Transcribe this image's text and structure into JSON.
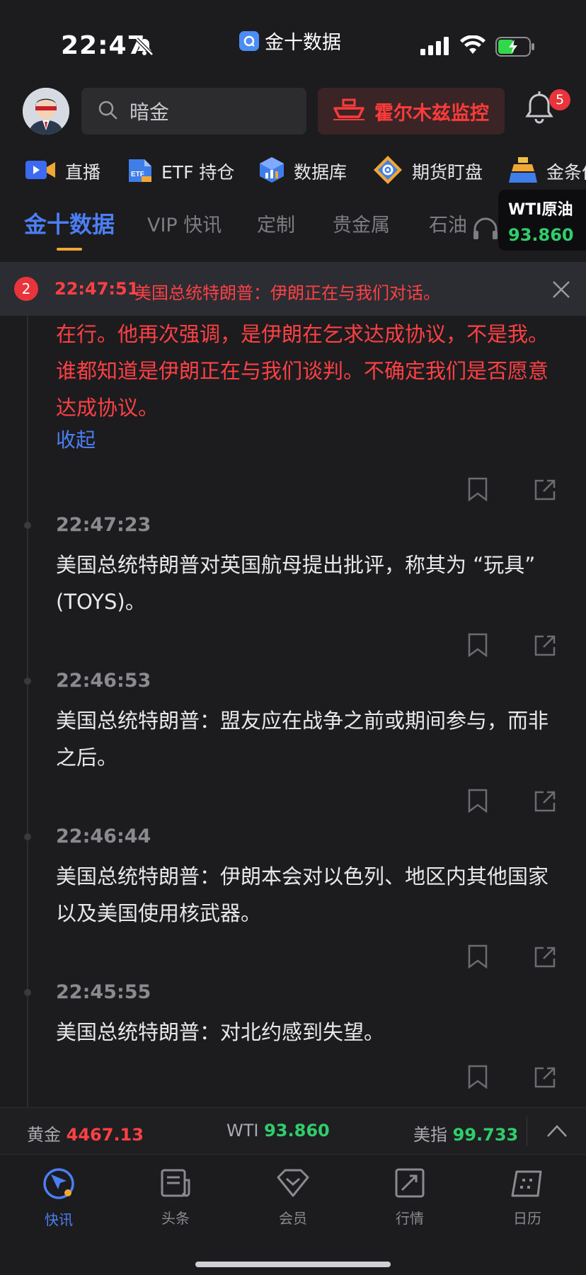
{
  "status_bar": {
    "time": "22:47",
    "app_name": "金十数据"
  },
  "header": {
    "search_placeholder": "暗金",
    "monitor_label": "霍尔木兹监控",
    "notification_count": "5"
  },
  "shortcuts": [
    {
      "label": "直播",
      "icon": "live-icon"
    },
    {
      "label": "ETF 持仓",
      "icon": "etf-icon"
    },
    {
      "label": "数据库",
      "icon": "database-icon"
    },
    {
      "label": "期货盯盘",
      "icon": "futures-icon"
    },
    {
      "label": "金条价",
      "icon": "gold-bar-icon"
    }
  ],
  "tabs": [
    {
      "label": "金十数据",
      "active": true
    },
    {
      "label": "VIP 快讯"
    },
    {
      "label": "定制"
    },
    {
      "label": "贵金属"
    },
    {
      "label": "石油"
    }
  ],
  "wti_card": {
    "name": "WTI原油",
    "value": "93.860"
  },
  "alert": {
    "count": "2",
    "time": "22:47:51",
    "text": "美国总统特朗普：伊朗正在与我们对话。"
  },
  "feed": {
    "expanded_text": "在行。他再次强调，是伊朗在乞求达成协议，不是我。谁都知道是伊朗正在与我们谈判。不确定我们是否愿意达成协议。",
    "collapse_label": "收起",
    "items": [
      {
        "time": "22:47:23",
        "text": "美国总统特朗普对英国航母提出批评，称其为 “玩具” (TOYS)。"
      },
      {
        "time": "22:46:53",
        "text": "美国总统特朗普：盟友应在战争之前或期间参与，而非之后。"
      },
      {
        "time": "22:46:44",
        "text": "美国总统特朗普：伊朗本会对以色列、地区内其他国家以及美国使用核武器。"
      },
      {
        "time": "22:45:55",
        "text": "美国总统特朗普：对北约感到失望。"
      }
    ]
  },
  "ticker": [
    {
      "name": "黄金",
      "value": "4467.13",
      "color": "#ff4044"
    },
    {
      "name": "WTI",
      "value": "93.860",
      "color": "#2fcd6b"
    },
    {
      "name": "美指",
      "value": "99.733",
      "color": "#2fcd6b"
    }
  ],
  "bottom_nav": [
    {
      "label": "快讯",
      "icon": "flash-news-icon",
      "active": true
    },
    {
      "label": "头条",
      "icon": "headlines-icon"
    },
    {
      "label": "会员",
      "icon": "membership-icon"
    },
    {
      "label": "行情",
      "icon": "market-icon"
    },
    {
      "label": "日历",
      "icon": "calendar-icon"
    }
  ]
}
